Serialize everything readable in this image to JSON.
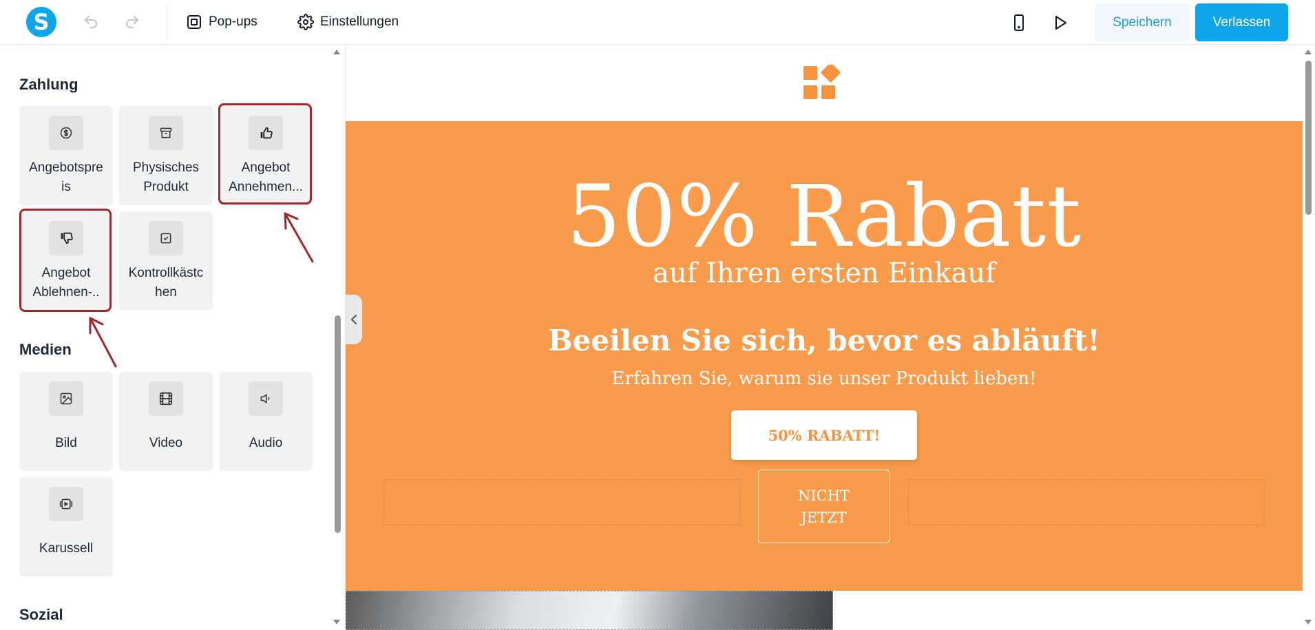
{
  "toolbar": {
    "logo_letter": "S",
    "popups_label": "Pop-ups",
    "settings_label": "Einstellungen",
    "save_label": "Speichern",
    "leave_label": "Verlassen",
    "accent_color": "#0ea5e9"
  },
  "sidebar": {
    "sections": [
      {
        "title": "Zahlung",
        "items": [
          {
            "label": "Angebotspreis",
            "label_lines": "Angebotspre\nis",
            "icon": "dollar-circle-icon"
          },
          {
            "label": "Physisches Produkt",
            "label_lines": "Physisches\nProdukt",
            "icon": "archive-box-icon"
          },
          {
            "label": "Angebot Annehmen...",
            "label_lines": "Angebot\nAnnehmen...",
            "icon": "thumbs-up-icon",
            "highlighted": true
          },
          {
            "label": "Angebot Ablehnen-..",
            "label_lines": "Angebot\nAblehnen-..",
            "icon": "thumbs-down-icon",
            "highlighted": true
          },
          {
            "label": "Kontrollkästchen",
            "label_lines": "Kontrollkästc\nhen",
            "icon": "checkbox-icon"
          }
        ]
      },
      {
        "title": "Medien",
        "items": [
          {
            "label": "Bild",
            "icon": "image-icon"
          },
          {
            "label": "Video",
            "icon": "video-icon"
          },
          {
            "label": "Audio",
            "icon": "speaker-icon"
          },
          {
            "label": "Karussell",
            "icon": "carousel-icon"
          }
        ]
      },
      {
        "title": "Sozial",
        "items": []
      }
    ],
    "annotation_color": "#a3262a"
  },
  "canvas": {
    "hero_color": "#fa9b4b",
    "brand_mark_color": "#f7923f",
    "headline": "50% Rabatt",
    "subheadline": "auf Ihren ersten Einkauf",
    "hurry_text": "Beeilen Sie sich, bevor es abläuft!",
    "why_text": "Erfahren Sie, warum sie unser Produkt lieben!",
    "cta_label": "50% RABATT!",
    "decline_label": "NICHT\nJETZT"
  }
}
